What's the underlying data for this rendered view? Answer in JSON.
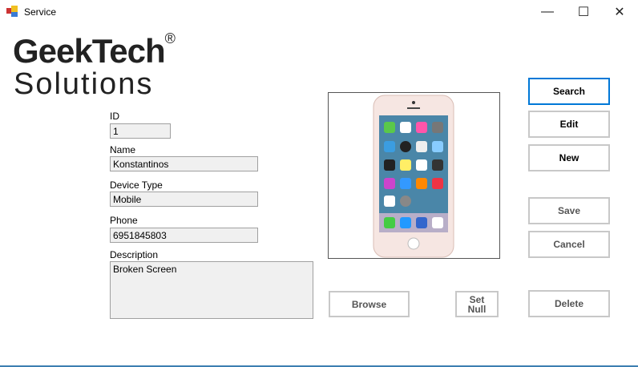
{
  "window": {
    "title": "Service",
    "minimize": "—",
    "maximize": "☐",
    "close": "✕"
  },
  "logo": {
    "line1": "GeekTech",
    "reg": "®",
    "line2": "Solutions"
  },
  "form": {
    "id_label": "ID",
    "id_value": "1",
    "name_label": "Name",
    "name_value": "Konstantinos",
    "device_label": "Device Type",
    "device_value": "Mobile",
    "phone_label": "Phone",
    "phone_value": "6951845803",
    "desc_label": "Description",
    "desc_value": "Broken Screen"
  },
  "buttons": {
    "search": "Search",
    "edit": "Edit",
    "new": "New",
    "save": "Save",
    "cancel": "Cancel",
    "delete": "Delete",
    "browse": "Browse",
    "set_null": "Set Null"
  },
  "colors": {
    "accent": "#0078d7",
    "phone_body": "#f2dcd6"
  }
}
